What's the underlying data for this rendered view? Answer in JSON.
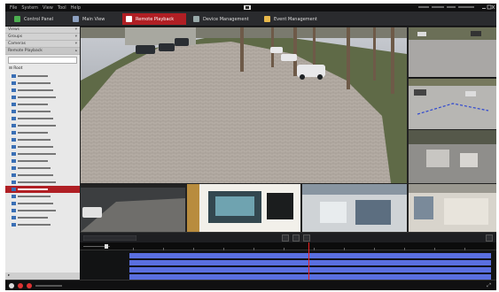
{
  "menu": {
    "items": [
      "File",
      "System",
      "View",
      "Tool",
      "Help"
    ]
  },
  "toolbar": {
    "tabs": [
      {
        "label": "Control Panel",
        "icon": "control-panel-icon"
      },
      {
        "label": "Main View",
        "icon": "grid-icon"
      },
      {
        "label": "Remote Playback",
        "icon": "playback-icon",
        "active": true
      },
      {
        "label": "Device Management",
        "icon": "device-icon"
      },
      {
        "label": "Event Management",
        "icon": "event-icon"
      }
    ]
  },
  "left_panel": {
    "sections": [
      "Views",
      "Groups",
      "Cameras",
      "Remote Playback"
    ],
    "root_label": "Root",
    "camera_count": 22,
    "selected_index": 16
  },
  "colors": {
    "accent": "#b01f24",
    "timeline_fill": "#5a6fe0",
    "cursor": "#e22222"
  }
}
